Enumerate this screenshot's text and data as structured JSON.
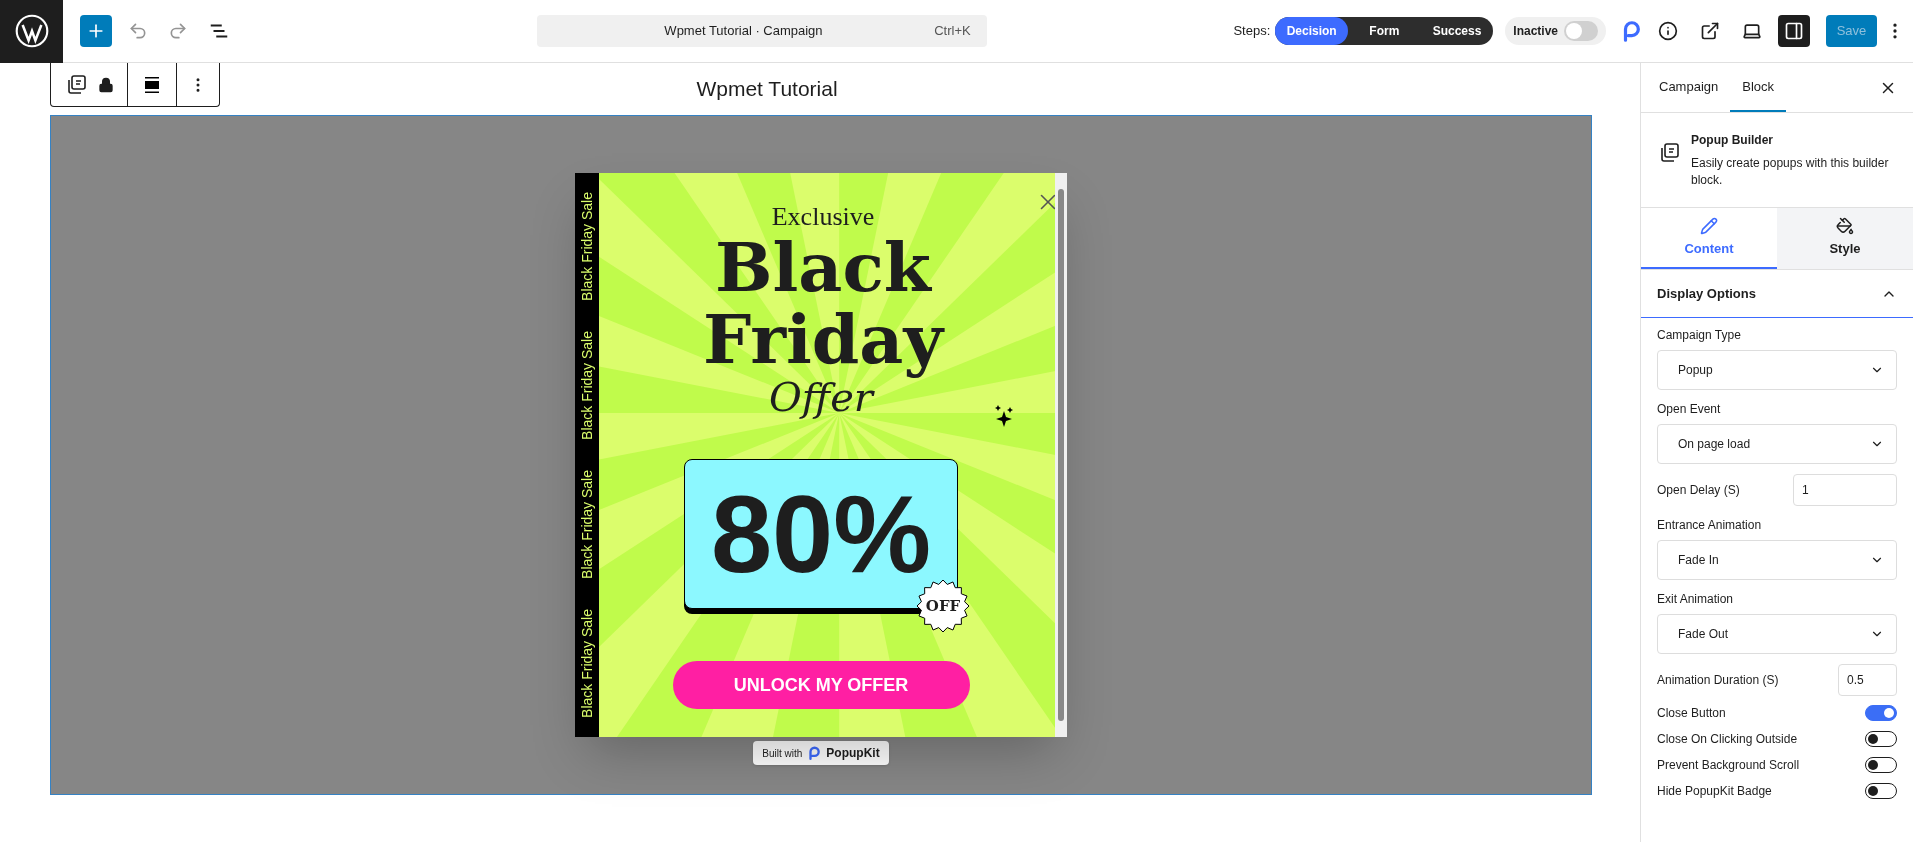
{
  "search": {
    "title": "Wpmet Tutorial · Campaign",
    "shortcut": "Ctrl+K"
  },
  "steps": {
    "label": "Steps:",
    "items": [
      {
        "label": "Decision",
        "selected": true
      },
      {
        "label": "Form",
        "selected": false
      },
      {
        "label": "Success",
        "selected": false
      }
    ]
  },
  "status": {
    "label": "Inactive",
    "on": false
  },
  "save": {
    "label": "Save",
    "disabled": true
  },
  "page_title": "Wpmet Tutorial",
  "popup": {
    "side_texts": [
      "Black Friday Sale",
      "Black Friday Sale",
      "Black Friday Sale",
      "Black Friday Sale"
    ],
    "eyebrow": "Exclusive",
    "headline": [
      "Black",
      "Friday"
    ],
    "script": "Offer",
    "discount": "80%",
    "badge": "OFF",
    "cta": "UNLOCK MY OFFER",
    "built_with": "Built with",
    "brand": "PopupKit"
  },
  "sidebar": {
    "tabs": [
      {
        "label": "Campaign",
        "selected": false
      },
      {
        "label": "Block",
        "selected": true
      }
    ],
    "block": {
      "title": "Popup Builder",
      "description": "Easily create popups with this builder block."
    },
    "subtabs": [
      {
        "label": "Content",
        "selected": true,
        "kind": "pencil"
      },
      {
        "label": "Style",
        "selected": false,
        "kind": "bucket"
      }
    ],
    "section": {
      "title": "Display Options",
      "expanded": true
    },
    "fields": [
      {
        "kind": "select",
        "label": "Campaign Type",
        "value": "Popup"
      },
      {
        "kind": "select",
        "label": "Open Event",
        "value": "On page load"
      },
      {
        "kind": "number",
        "label": "Open Delay (S)",
        "value": "1"
      },
      {
        "kind": "select",
        "label": "Entrance Animation",
        "value": "Fade In"
      },
      {
        "kind": "select",
        "label": "Exit Animation",
        "value": "Fade Out"
      },
      {
        "kind": "number",
        "label": "Animation Duration (S)",
        "value": "0.5"
      },
      {
        "kind": "toggle",
        "label": "Close Button",
        "on": true
      },
      {
        "kind": "toggle",
        "label": "Close On Clicking Outside",
        "on": false
      },
      {
        "kind": "toggle",
        "label": "Prevent Background Scroll",
        "on": false
      },
      {
        "kind": "toggle",
        "label": "Hide PopupKit Badge",
        "on": false
      }
    ]
  }
}
